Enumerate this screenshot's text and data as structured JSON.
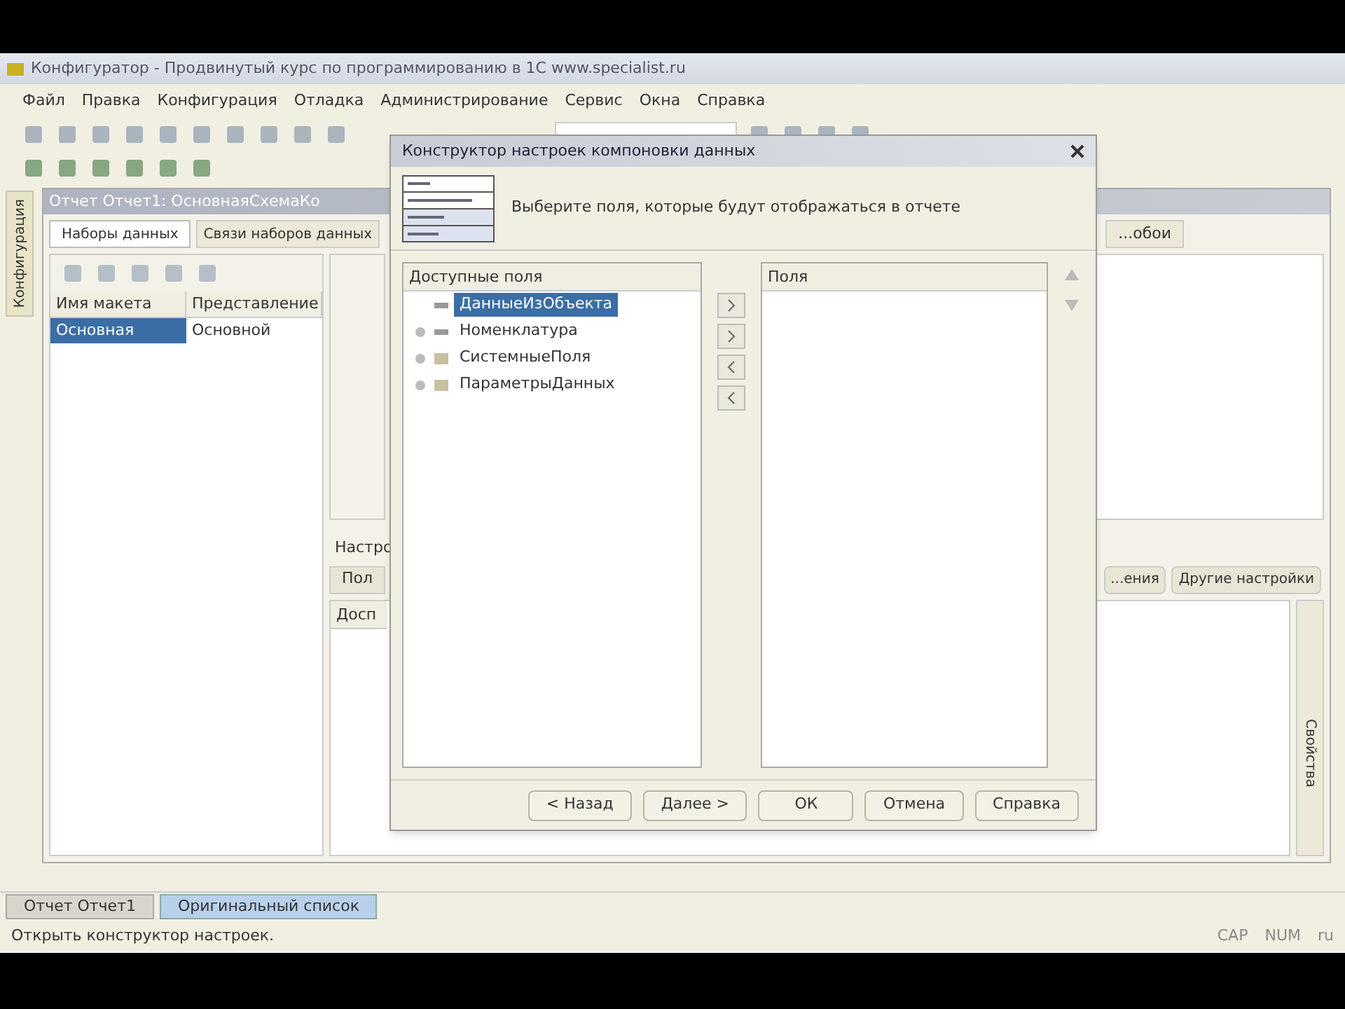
{
  "window": {
    "title": "Конфигуратор - Продвинутый курс по программированию в 1С www.specialist.ru"
  },
  "menu": [
    "Файл",
    "Правка",
    "Конфигурация",
    "Отладка",
    "Администрирование",
    "Сервис",
    "Окна",
    "Справка"
  ],
  "left_sidebar_tab": "Конфигурация",
  "right_sidebar_tab": "Свойства",
  "child_window": {
    "title": "Отчет Отчет1: ОсновнаяСхемаКо",
    "tabs": [
      {
        "label": "Наборы данных",
        "selected": true
      },
      {
        "label": "Связи наборов данных",
        "selected": false
      }
    ],
    "right_tab": "...обои",
    "schemas": {
      "columns": [
        "Имя макета",
        "Представление"
      ],
      "rows": [
        {
          "cells": [
            "Основная",
            "Основной"
          ],
          "selected": true
        }
      ]
    },
    "settings_label": "Настро",
    "settings_tab": "Пол",
    "available_header": "Досп",
    "buttons": [
      "...ения",
      "Другие настройки"
    ]
  },
  "dialog": {
    "title": "Конструктор настроек компоновки данных",
    "instruction": "Выберите поля, которые будут отображаться в отчете",
    "available_header": "Доступные поля",
    "fields": [
      {
        "label": "ДанныеИзОбъекта",
        "kind": "field",
        "expandable": false,
        "selected": true
      },
      {
        "label": "Номенклатура",
        "kind": "field",
        "expandable": true,
        "selected": false
      },
      {
        "label": "СистемныеПоля",
        "kind": "folder",
        "expandable": true,
        "selected": false
      },
      {
        "label": "ПараметрыДанных",
        "kind": "folder",
        "expandable": true,
        "selected": false
      }
    ],
    "chosen_header": "Поля",
    "buttons": [
      "< Назад",
      "Далее >",
      "ОК",
      "Отмена",
      "Справка"
    ]
  },
  "taskbar": [
    {
      "label": "Отчет Отчет1",
      "selected": false
    },
    {
      "label": "Оригинальный список",
      "selected": true
    }
  ],
  "status": {
    "text": "Открыть конструктор настроек.",
    "indicators": [
      "CAP",
      "NUM",
      "ru"
    ]
  }
}
